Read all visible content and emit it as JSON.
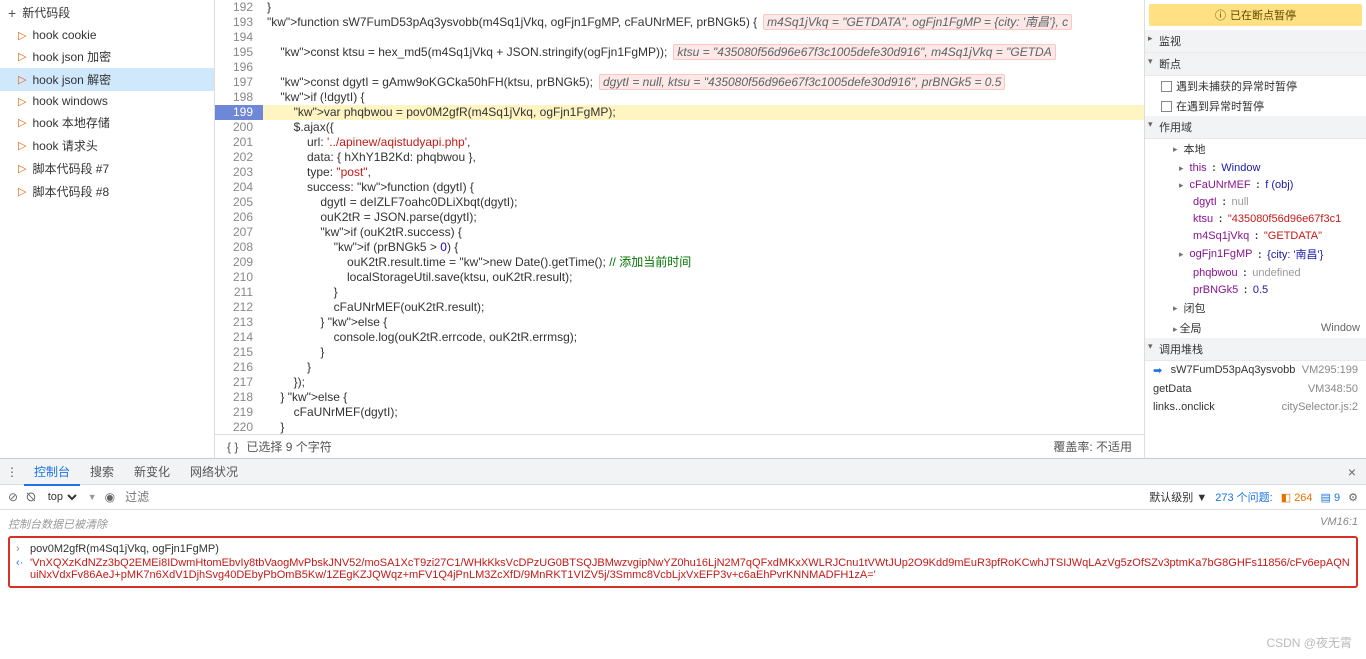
{
  "sidebar": {
    "new_label": "新代码段",
    "items": [
      {
        "label": "hook cookie"
      },
      {
        "label": "hook json 加密"
      },
      {
        "label": "hook json 解密"
      },
      {
        "label": "hook windows"
      },
      {
        "label": "hook 本地存储"
      },
      {
        "label": "hook 请求头"
      },
      {
        "label": "脚本代码段 #7"
      },
      {
        "label": "脚本代码段 #8"
      }
    ],
    "selected_index": 2
  },
  "code": {
    "highlight_line": 199,
    "lines": [
      {
        "n": 192,
        "txt": "}"
      },
      {
        "n": 193,
        "txt": "function sW7FumD53pAq3ysvobb(m4Sq1jVkq, ogFjn1FgMP, cFaUNrMEF, prBNGk5) {",
        "hint": "m4Sq1jVkq = \"GETDATA\", ogFjn1FgMP = {city: '南昌'}, c"
      },
      {
        "n": 194,
        "txt": ""
      },
      {
        "n": 195,
        "txt": "    const ktsu = hex_md5(m4Sq1jVkq + JSON.stringify(ogFjn1FgMP));",
        "hint": "ktsu = \"435080f56d96e67f3c1005defe30d916\", m4Sq1jVkq = \"GETDA"
      },
      {
        "n": 196,
        "txt": ""
      },
      {
        "n": 197,
        "txt": "    const dgytI = gAmw9oKGCka50hFH(ktsu, prBNGk5);",
        "hint": "dgytI = null, ktsu = \"435080f56d96e67f3c1005defe30d916\", prBNGk5 = 0.5"
      },
      {
        "n": 198,
        "txt": "    if (!dgytI) {"
      },
      {
        "n": 199,
        "txt": "        var phqbwou = pov0M2gfR(m4Sq1jVkq, ogFjn1FgMP);"
      },
      {
        "n": 200,
        "txt": "        $.ajax({"
      },
      {
        "n": 201,
        "txt": "            url: '../apinew/aqistudyapi.php',"
      },
      {
        "n": 202,
        "txt": "            data: { hXhY1B2Kd: phqbwou },"
      },
      {
        "n": 203,
        "txt": "            type: \"post\","
      },
      {
        "n": 204,
        "txt": "            success: function (dgytI) {"
      },
      {
        "n": 205,
        "txt": "                dgytI = deIZLF7oahc0DLiXbqt(dgytI);"
      },
      {
        "n": 206,
        "txt": "                ouK2tR = JSON.parse(dgytI);"
      },
      {
        "n": 207,
        "txt": "                if (ouK2tR.success) {"
      },
      {
        "n": 208,
        "txt": "                    if (prBNGk5 > 0) {"
      },
      {
        "n": 209,
        "txt": "                        ouK2tR.result.time = new Date().getTime(); // 添加当前时间"
      },
      {
        "n": 210,
        "txt": "                        localStorageUtil.save(ktsu, ouK2tR.result);"
      },
      {
        "n": 211,
        "txt": "                    }"
      },
      {
        "n": 212,
        "txt": "                    cFaUNrMEF(ouK2tR.result);"
      },
      {
        "n": 213,
        "txt": "                } else {"
      },
      {
        "n": 214,
        "txt": "                    console.log(ouK2tR.errcode, ouK2tR.errmsg);"
      },
      {
        "n": 215,
        "txt": "                }"
      },
      {
        "n": 216,
        "txt": "            }"
      },
      {
        "n": 217,
        "txt": "        });"
      },
      {
        "n": 218,
        "txt": "    } else {"
      },
      {
        "n": 219,
        "txt": "        cFaUNrMEF(dgytI);"
      },
      {
        "n": 220,
        "txt": "    }"
      }
    ],
    "status_left": "已选择 9 个字符",
    "status_right": "覆盖率: 不适用"
  },
  "debugger": {
    "paused_msg": "已在断点暂停",
    "sections": {
      "watch": "监视",
      "breakpoints": "断点",
      "bp1": "遇到未捕获的异常时暂停",
      "bp2": "在遇到异常时暂停",
      "scope": "作用域",
      "local": "本地",
      "closure": "闭包",
      "global": "全局",
      "global_val": "Window",
      "callstack": "调用堆栈"
    },
    "scope_vars": [
      {
        "k": "this",
        "v": "Window",
        "arrow": true
      },
      {
        "k": "cFaUNrMEF",
        "v": "f (obj)",
        "arrow": true
      },
      {
        "k": "dgytI",
        "v": "null",
        "cls": "scope-null"
      },
      {
        "k": "ktsu",
        "v": "\"435080f56d96e67f3c1",
        "cls": "scope-str"
      },
      {
        "k": "m4Sq1jVkq",
        "v": "\"GETDATA\"",
        "cls": "scope-str"
      },
      {
        "k": "ogFjn1FgMP",
        "v": "{city: '南昌'}",
        "arrow": true
      },
      {
        "k": "phqbwou",
        "v": "undefined",
        "cls": "scope-null"
      },
      {
        "k": "prBNGk5",
        "v": "0.5",
        "cls": "scope-val"
      }
    ],
    "callstack": [
      {
        "fn": "sW7FumD53pAq3ysvobb",
        "loc": "VM295:199",
        "current": true
      },
      {
        "fn": "getData",
        "loc": "VM348:50"
      },
      {
        "fn": "links.<computed>.onclick",
        "loc": "citySelector.js:2"
      }
    ]
  },
  "console": {
    "tabs": [
      "控制台",
      "搜索",
      "新变化",
      "网络状况"
    ],
    "active_tab": 0,
    "context": "top",
    "filter_placeholder": "过滤",
    "level": "默认级别",
    "issues": "273 个问题:",
    "warn": "264",
    "info": "9",
    "cleared_msg": "控制台数据已被清除",
    "cleared_src": "VM16:1",
    "input": "pov0M2gfR(m4Sq1jVkq, ogFjn1FgMP)",
    "output": "'VnXQXzKdNZz3bQ2EMEi8IDwmHtomEbvIy8tbVaogMvPbskJNV52/moSA1XcT9zi27C1/WHkKksVcDPzUG0BTSQJBMwzvgipNwYZ0hu16LjN2M7qQFxdMKxXWLRJCnu1tVWtJUp2O9Kdd9mEuR3pfRoKCwhJTSIJWqLAzVg5zOfSZv3ptmKa7bG8GHFs11856/cFv6epAQNuiNxVdxFv86AeJ+pMK7n6XdV1DjhSvg40DEbyPbOmB5Kw/1ZEgKZJQWqz+mFV1Q4jPnLM3ZcXfD/9MnRKT1VIZV5j/3Smmc8VcbLjxVxEFP3v+c6aEhPvrKNNMADFH1zA='"
  },
  "watermark": "CSDN @夜无霄"
}
